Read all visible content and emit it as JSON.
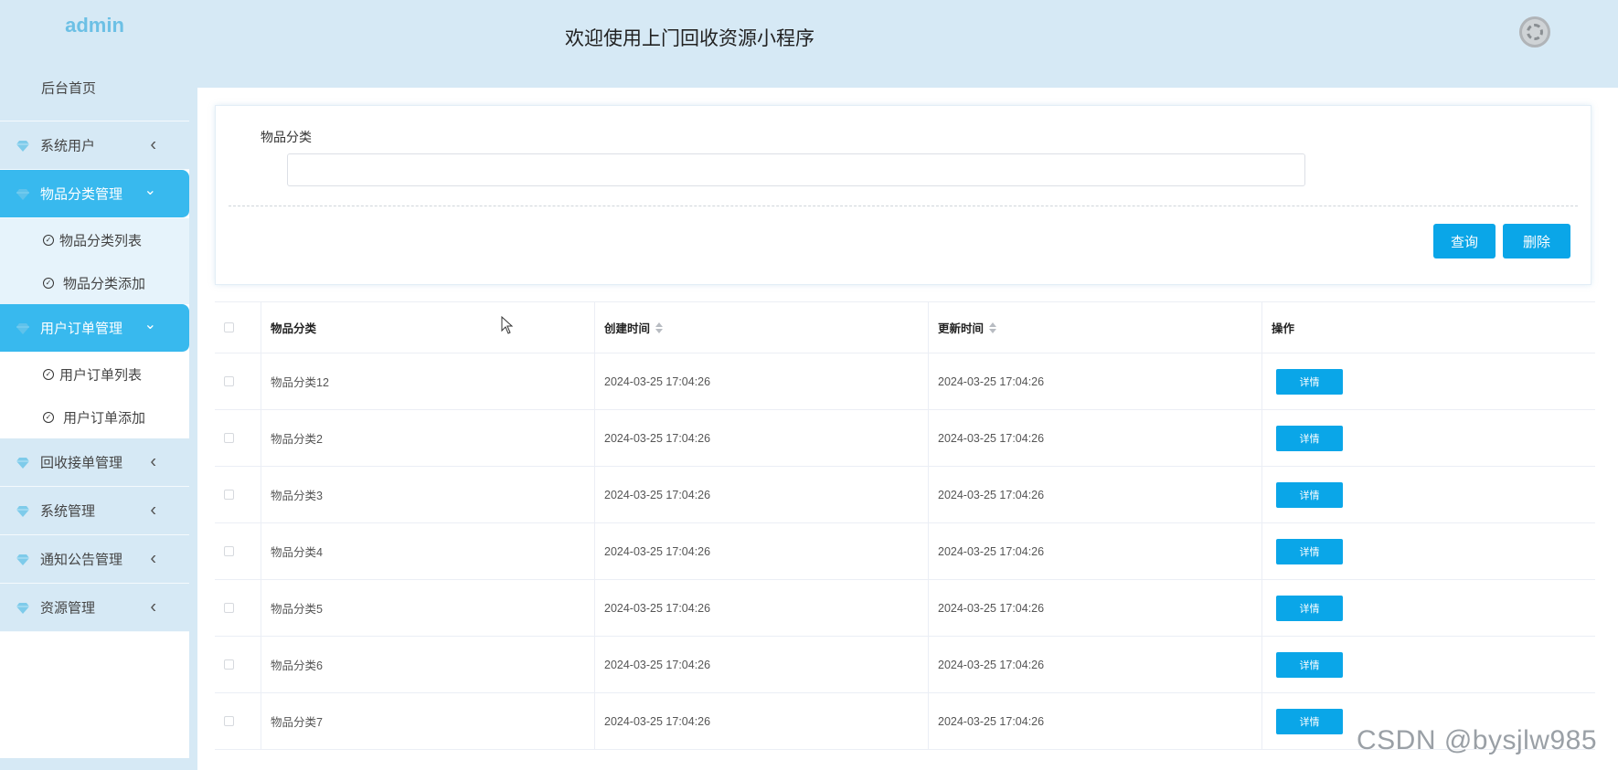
{
  "brand": "admin",
  "header": {
    "title": "欢迎使用上门回收资源小程序"
  },
  "sidebar": {
    "home": "后台首页",
    "items": [
      {
        "label": "系统用户",
        "expanded": false
      },
      {
        "label": "物品分类管理",
        "expanded": true,
        "children": [
          "物品分类列表",
          "物品分类添加"
        ]
      },
      {
        "label": "用户订单管理",
        "expanded": true,
        "children": [
          "用户订单列表",
          "用户订单添加"
        ]
      },
      {
        "label": "回收接单管理",
        "expanded": false
      },
      {
        "label": "系统管理",
        "expanded": false
      },
      {
        "label": "通知公告管理",
        "expanded": false
      },
      {
        "label": "资源管理",
        "expanded": false
      }
    ]
  },
  "search": {
    "label": "物品分类",
    "value": "",
    "query_button": "查询",
    "delete_button": "删除"
  },
  "table": {
    "headers": [
      "物品分类",
      "创建时间",
      "更新时间",
      "操作"
    ],
    "sortable": [
      false,
      true,
      true,
      false
    ],
    "detail_label": "详情",
    "rows": [
      {
        "name": "物品分类12",
        "created": "2024-03-25 17:04:26",
        "updated": "2024-03-25 17:04:26"
      },
      {
        "name": "物品分类2",
        "created": "2024-03-25 17:04:26",
        "updated": "2024-03-25 17:04:26"
      },
      {
        "name": "物品分类3",
        "created": "2024-03-25 17:04:26",
        "updated": "2024-03-25 17:04:26"
      },
      {
        "name": "物品分类4",
        "created": "2024-03-25 17:04:26",
        "updated": "2024-03-25 17:04:26"
      },
      {
        "name": "物品分类5",
        "created": "2024-03-25 17:04:26",
        "updated": "2024-03-25 17:04:26"
      },
      {
        "name": "物品分类6",
        "created": "2024-03-25 17:04:26",
        "updated": "2024-03-25 17:04:26"
      },
      {
        "name": "物品分类7",
        "created": "2024-03-25 17:04:26",
        "updated": "2024-03-25 17:04:26"
      }
    ]
  },
  "watermark": "CSDN @bysjlw985",
  "colors": {
    "accent": "#0aa6e8",
    "sidebar_bg": "#d6e9f5",
    "sidebar_active": "#38b9ee",
    "brand": "#6cc0e5"
  },
  "icons": {
    "menu": "diamond-icon",
    "submenu": "check-circle-icon",
    "collapsed": "chevron-left-icon",
    "expanded": "chevron-down-icon",
    "header_right": "loading-spinner-icon"
  }
}
